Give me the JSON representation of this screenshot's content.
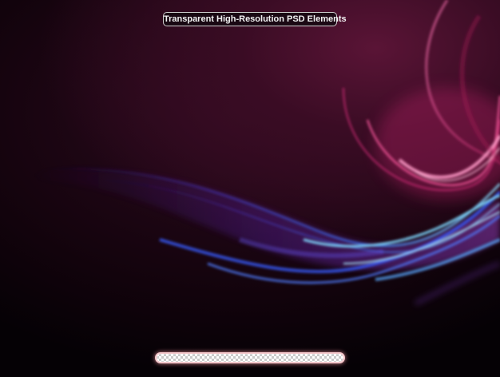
{
  "badge": {
    "text": "Transparent High-Resolution PSD Elements"
  },
  "colors": {
    "background": "#12030c",
    "pink_wave": "#e0307f",
    "blue_wave": "#3a5cff",
    "cyan_highlight": "#7fd8ff",
    "violet_wave": "#6b2bd6"
  },
  "icons": {
    "transparency_preview": "checkerboard-transparency-bar"
  }
}
